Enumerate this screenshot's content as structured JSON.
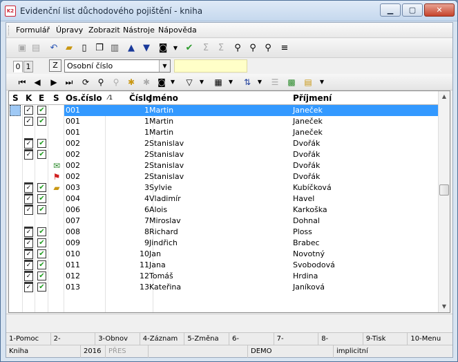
{
  "window": {
    "title": "Evidenční list důchodového pojištění - kniha",
    "app_icon_text": "K2"
  },
  "menu": [
    {
      "label": "Formulář"
    },
    {
      "label": "Úpravy"
    },
    {
      "label": "Zobrazit"
    },
    {
      "label": "Nástroje"
    },
    {
      "label": "Nápověda"
    }
  ],
  "selector": {
    "tab0": "0",
    "tab1": "1",
    "z_button": "Z",
    "sort_value": "Osobní číslo",
    "find_value": ""
  },
  "grid": {
    "columns": {
      "s": "S",
      "k": "K",
      "e": "E",
      "s2": "S",
      "os": "Os.číslo",
      "sortmark": "⁄1",
      "cislo": "Číslo",
      "jmeno": "Jméno",
      "prijmeni": "Příjmení"
    },
    "rows": [
      {
        "os": "001",
        "cislo": "1",
        "jmeno": "Martin",
        "prijmeni": "Janeček",
        "k": "check",
        "e": true,
        "s": "",
        "selected": true
      },
      {
        "os": "001",
        "cislo": "1",
        "jmeno": "Martin",
        "prijmeni": "Janeček",
        "k": "check",
        "e": true,
        "s": ""
      },
      {
        "os": "001",
        "cislo": "1",
        "jmeno": "Martin",
        "prijmeni": "Janeček",
        "k": "",
        "e": false,
        "s": ""
      },
      {
        "os": "002",
        "cislo": "2",
        "jmeno": "Stanislav",
        "prijmeni": "Dvořák",
        "k": "clip",
        "e": true,
        "s": ""
      },
      {
        "os": "002",
        "cislo": "2",
        "jmeno": "Stanislav",
        "prijmeni": "Dvořák",
        "k": "clip",
        "e": true,
        "s": ""
      },
      {
        "os": "002",
        "cislo": "2",
        "jmeno": "Stanislav",
        "prijmeni": "Dvořák",
        "k": "",
        "e": false,
        "s": "mail"
      },
      {
        "os": "002",
        "cislo": "2",
        "jmeno": "Stanislav",
        "prijmeni": "Dvořák",
        "k": "",
        "e": false,
        "s": "pin"
      },
      {
        "os": "003",
        "cislo": "3",
        "jmeno": "Sylvie",
        "prijmeni": "Kubíčková",
        "k": "clip",
        "e": true,
        "s": "folder"
      },
      {
        "os": "004",
        "cislo": "4",
        "jmeno": "Vladimír",
        "prijmeni": "Havel",
        "k": "clip",
        "e": true,
        "s": ""
      },
      {
        "os": "006",
        "cislo": "6",
        "jmeno": "Alois",
        "prijmeni": "Karkoška",
        "k": "clip",
        "e": true,
        "s": ""
      },
      {
        "os": "007",
        "cislo": "7",
        "jmeno": "Miroslav",
        "prijmeni": "Dohnal",
        "k": "",
        "e": false,
        "s": ""
      },
      {
        "os": "008",
        "cislo": "8",
        "jmeno": "Richard",
        "prijmeni": "Ploss",
        "k": "clip",
        "e": true,
        "s": ""
      },
      {
        "os": "009",
        "cislo": "9",
        "jmeno": "Jindřich",
        "prijmeni": "Brabec",
        "k": "clip",
        "e": true,
        "s": ""
      },
      {
        "os": "010",
        "cislo": "10",
        "jmeno": "Jan",
        "prijmeni": "Novotný",
        "k": "clip",
        "e": true,
        "s": ""
      },
      {
        "os": "011",
        "cislo": "11",
        "jmeno": "Jana",
        "prijmeni": "Svobodová",
        "k": "clip",
        "e": true,
        "s": ""
      },
      {
        "os": "012",
        "cislo": "12",
        "jmeno": "Tomáš",
        "prijmeni": "Hrdina",
        "k": "clip",
        "e": true,
        "s": ""
      },
      {
        "os": "013",
        "cislo": "13",
        "jmeno": "Kateřina",
        "prijmeni": "Janíková",
        "k": "clip",
        "e": true,
        "s": ""
      }
    ]
  },
  "fkeys": [
    "1-Pomoc",
    "2-",
    "3-Obnov",
    "4-Záznam",
    "5-Změna",
    "6-",
    "7-",
    "8-",
    "9-Tisk",
    "10-Menu"
  ],
  "status": {
    "book": "Kniha",
    "year": "2016",
    "mode": "PŘES",
    "db": "DEMO",
    "profile": "implicitní"
  },
  "colors": {
    "selection": "#3399ff",
    "find_field": "#ffffc8",
    "check_green": "#1c9c1c"
  }
}
